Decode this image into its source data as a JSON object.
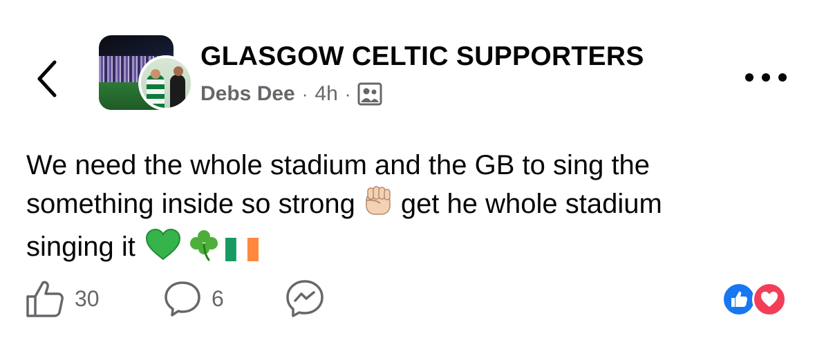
{
  "header": {
    "group_name": "GLASGOW CELTIC SUPPORTERS",
    "author": "Debs Dee",
    "separator": "·",
    "time": "4h",
    "audience_icon": "members-group-icon",
    "back_icon": "chevron-left-icon",
    "more_icon": "more-horizontal-icon"
  },
  "post": {
    "lines": [
      "We need the whole stadium and the GB to sing the",
      "something inside so strong",
      "get he whole stadium",
      "singing it"
    ],
    "emojis": [
      "raised-fist-emoji",
      "green-heart-emoji",
      "shamrock-emoji",
      "ireland-flag-emoji"
    ]
  },
  "actions": {
    "like_count": "30",
    "comment_count": "6",
    "like_icon": "thumbs-up-icon",
    "comment_icon": "comment-bubble-icon",
    "share_icon": "messenger-icon"
  },
  "reactions": [
    "like-reaction-icon",
    "love-reaction-icon"
  ],
  "colors": {
    "text": "#050505",
    "secondary": "#65676b",
    "like_blue": "#1877f2",
    "love_red": "#f33e58",
    "green_heart": "#36b34a",
    "flag_green": "#169b62",
    "flag_orange": "#ff883e"
  }
}
